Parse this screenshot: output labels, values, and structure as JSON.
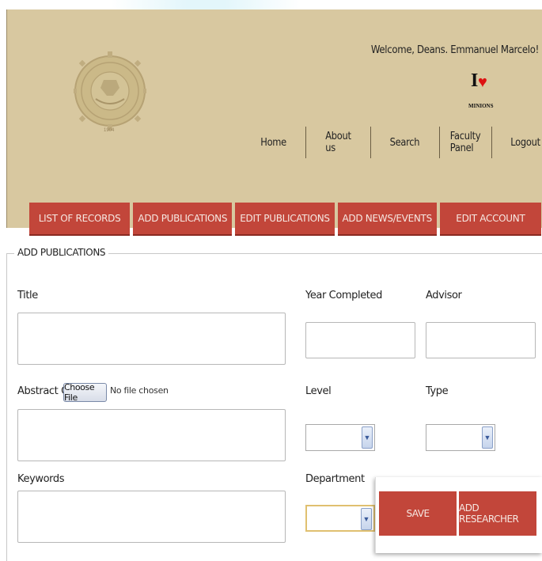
{
  "header": {
    "welcome": "Welcome, Deans. Emmanuel Marcelo!",
    "badge_letter": "I",
    "badge_heart": "♥",
    "badge_text": "MINIONS",
    "seal_year": "1904",
    "nav": [
      "Home",
      "About us",
      "Search",
      "Faculty Panel",
      "Logout"
    ]
  },
  "menu": [
    "LIST OF RECORDS",
    "ADD PUBLICATIONS",
    "EDIT PUBLICATIONS",
    "ADD NEWS/EVENTS",
    "EDIT ACCOUNT"
  ],
  "form": {
    "section_title": "ADD PUBLICATIONS",
    "title_label": "Title",
    "year_label": "Year Completed",
    "advisor_label": "Advisor",
    "abstract_label": "Abstract OR",
    "choose_file": "Choose File",
    "no_file": "No file chosen",
    "level_label": "Level",
    "type_label": "Type",
    "keywords_label": "Keywords",
    "department_label": "Department"
  },
  "actions": {
    "save": "SAVE",
    "add_researcher": "ADD RESEARCHER"
  },
  "colors": {
    "header_bg": "#d8c8a0",
    "accent_red": "#c2463a"
  }
}
